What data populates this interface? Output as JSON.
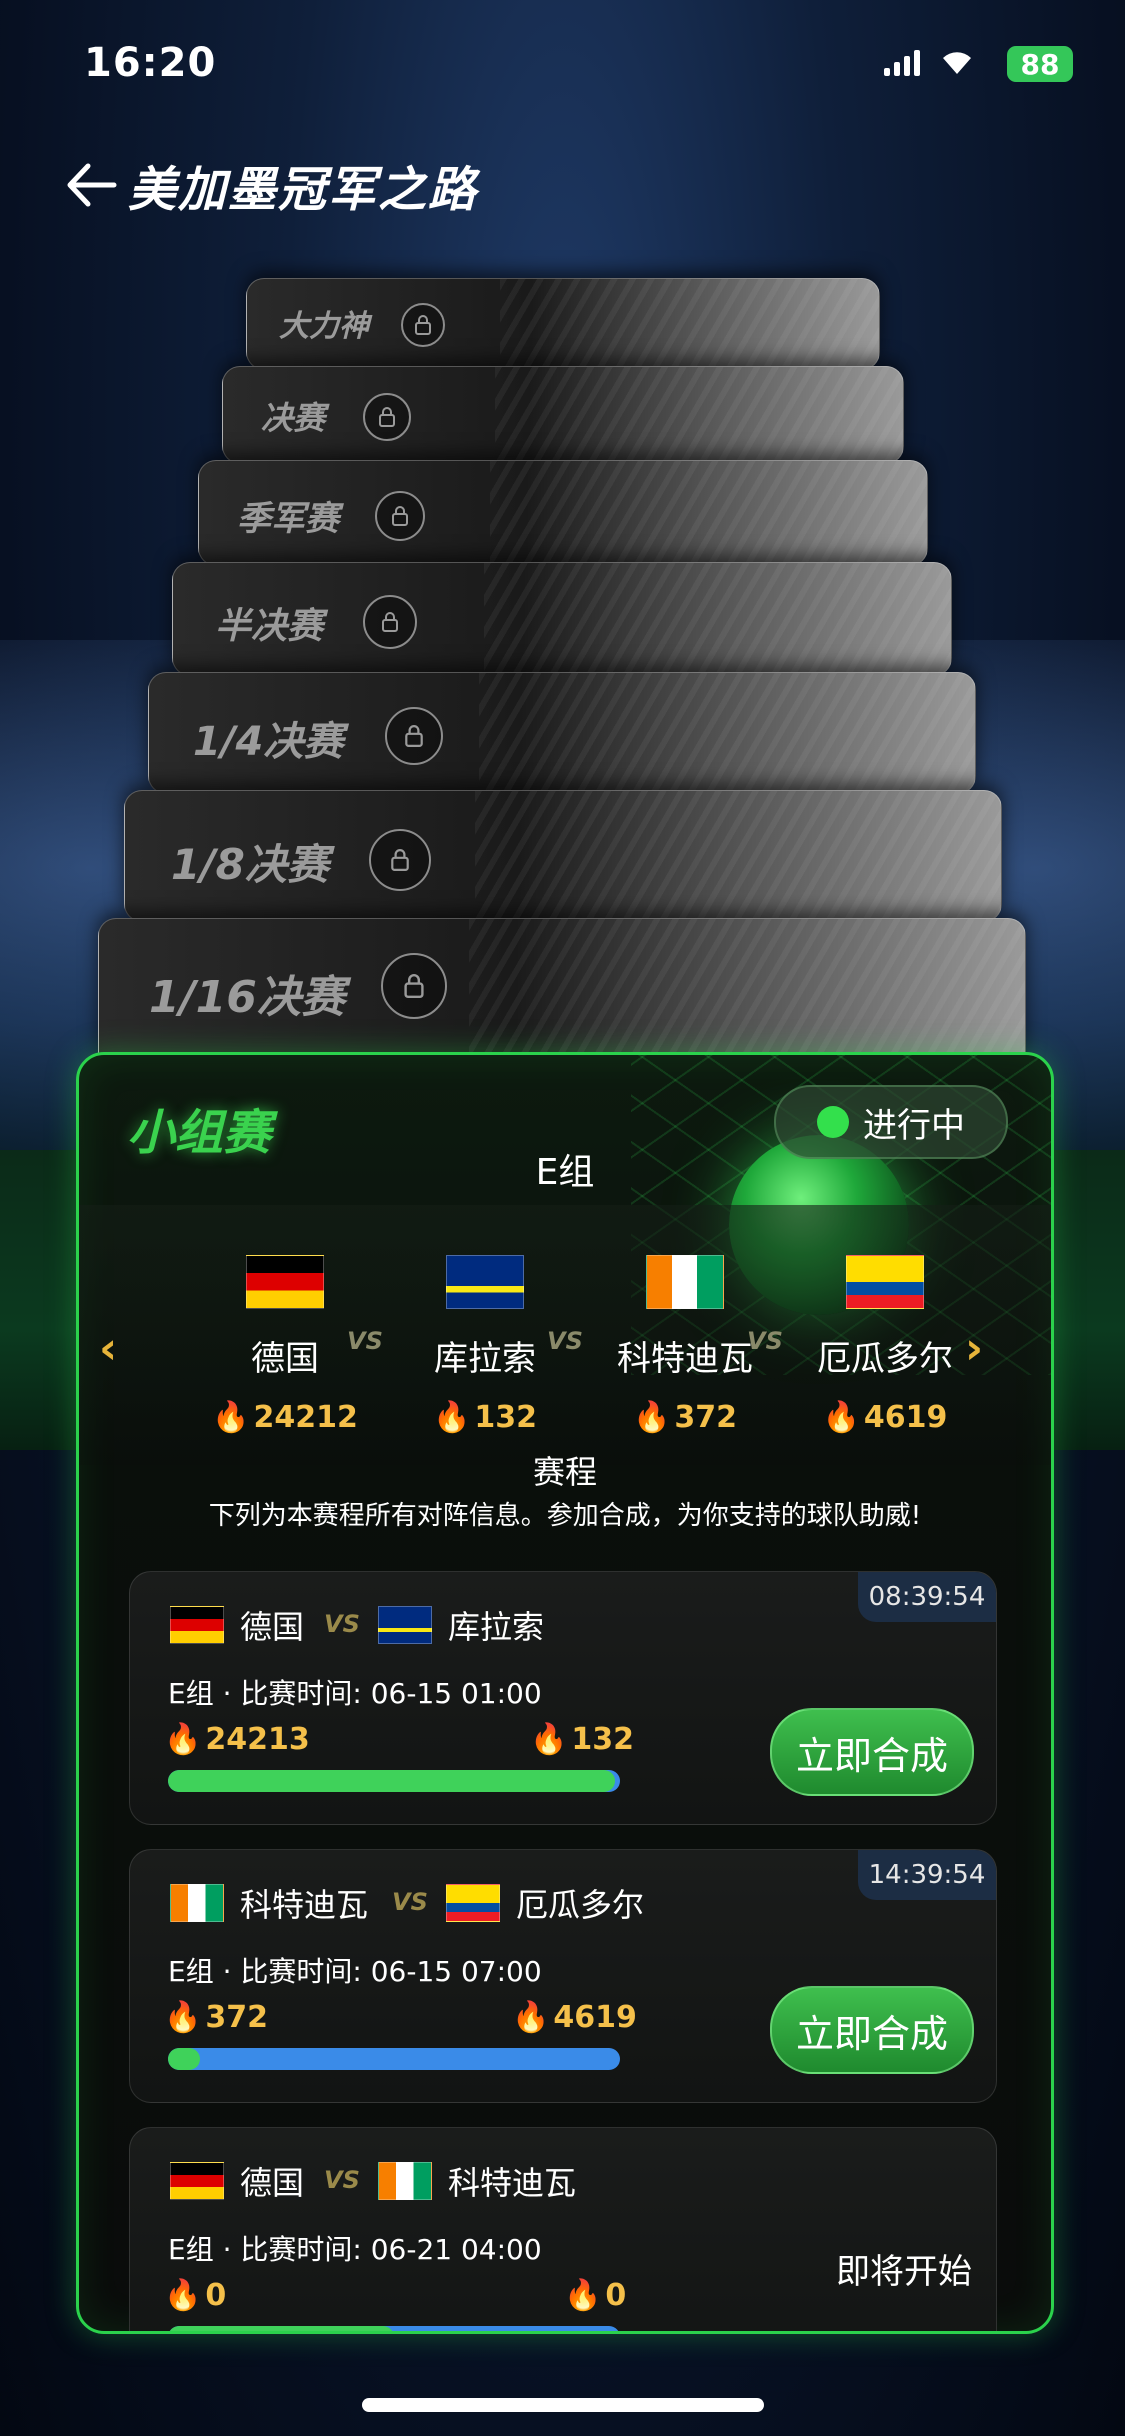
{
  "status_bar": {
    "time": "16:20",
    "battery": "88"
  },
  "header": {
    "title": "美加墨冠军之路"
  },
  "stages": [
    {
      "label": "大力神"
    },
    {
      "label": "决赛"
    },
    {
      "label": "季军赛"
    },
    {
      "label": "半决赛"
    },
    {
      "label": "1/4决赛"
    },
    {
      "label": "1/8决赛"
    },
    {
      "label": "1/16决赛"
    }
  ],
  "panel": {
    "title": "小组赛",
    "status": "进行中",
    "group": "E组",
    "teams": [
      {
        "name": "德国",
        "heat": "24212"
      },
      {
        "name": "库拉索",
        "heat": "132"
      },
      {
        "name": "科特迪瓦",
        "heat": "372"
      },
      {
        "name": "厄瓜多尔",
        "heat": "4619"
      }
    ],
    "vs": "VS",
    "schedule_title": "赛程",
    "schedule_desc": "下列为本赛程所有对阵信息。参加合成，为你支持的球队助威!",
    "matches": [
      {
        "countdown": "08:39:54",
        "home": "德国",
        "away": "库拉索",
        "info": "E组 · 比赛时间: 06-15 01:00",
        "home_heat": "24213",
        "away_heat": "132",
        "home_share": 0.99,
        "button": "立即合成"
      },
      {
        "countdown": "14:39:54",
        "home": "科特迪瓦",
        "away": "厄瓜多尔",
        "info": "E组 · 比赛时间: 06-15 07:00",
        "home_heat": "372",
        "away_heat": "4619",
        "home_share": 0.07,
        "button": "立即合成"
      },
      {
        "home": "德国",
        "away": "科特迪瓦",
        "info": "E组 · 比赛时间: 06-21 04:00",
        "home_heat": "0",
        "away_heat": "0",
        "home_share": 0.5,
        "state": "即将开始"
      }
    ]
  },
  "colors": {
    "accent": "#2bd24c",
    "heat": "#f5c04a",
    "away_bar": "#3a8be8",
    "home_bar": "#3fd25a"
  }
}
